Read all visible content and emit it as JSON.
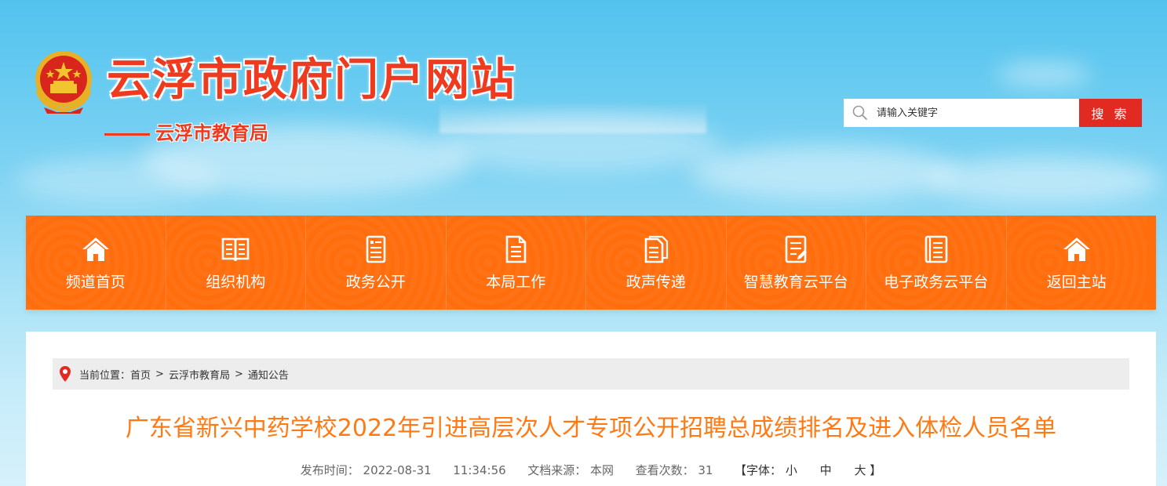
{
  "header": {
    "site_title": "云浮市政府门户网站",
    "sub_title": "云浮市教育局"
  },
  "search": {
    "placeholder": "请输入关键字",
    "button_label": "搜 索"
  },
  "nav": {
    "items": [
      {
        "label": "频道首页",
        "icon": "home-icon"
      },
      {
        "label": "组织机构",
        "icon": "book-icon"
      },
      {
        "label": "政务公开",
        "icon": "document-icon"
      },
      {
        "label": "本局工作",
        "icon": "file-list-icon"
      },
      {
        "label": "政声传递",
        "icon": "files-icon"
      },
      {
        "label": "智慧教育云平台",
        "icon": "form-icon"
      },
      {
        "label": "电子政务云平台",
        "icon": "ledger-icon"
      },
      {
        "label": "返回主站",
        "icon": "home-icon"
      }
    ]
  },
  "breadcrumb": {
    "prefix": "当前位置：",
    "items": [
      "首页",
      "云浮市教育局",
      "通知公告"
    ],
    "separator": ">"
  },
  "article": {
    "title": "广东省新兴中药学校2022年引进高层次人才专项公开招聘总成绩排名及进入体检人员名单",
    "publish_label": "发布时间：",
    "publish_date": "2022-08-31",
    "publish_time": "11:34:56",
    "source_label": "文档来源：",
    "source": "本网",
    "views_label": "查看次数：",
    "views": "31",
    "font_label_open": "【字体：",
    "font_small": "小",
    "font_medium": "中",
    "font_large": "大",
    "font_label_close": "】"
  },
  "colors": {
    "nav_bg": "#ff6d0d",
    "title_red": "#ee3a1f",
    "search_button": "#e12a22",
    "article_title": "#ff7a14"
  }
}
